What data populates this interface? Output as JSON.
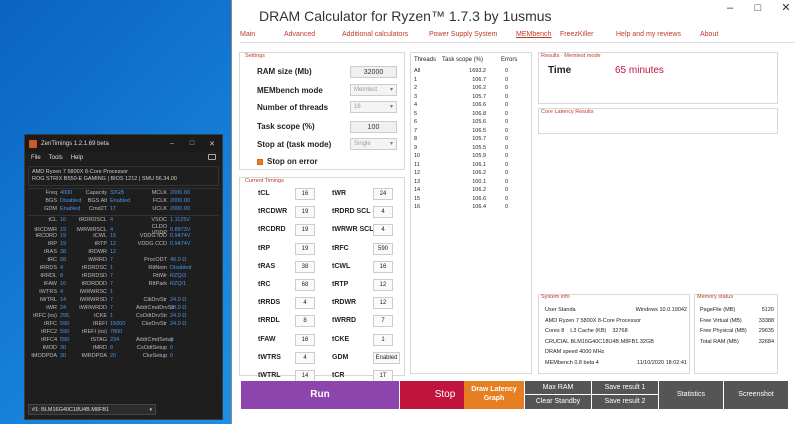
{
  "zen": {
    "title": "ZenTimings 1.2.1.69 beta",
    "menu": [
      "File",
      "Tools",
      "Help"
    ],
    "cpu": "AMD Ryzen 7 5800X 8-Core Processor",
    "board": "ROG STRIX B550-E GAMING | BIOS 1212 | SMU 56.34.00",
    "top": [
      [
        "Freq",
        "4000",
        "Capacity",
        "32GB",
        "MCLK",
        "2000.00"
      ],
      [
        "BGS",
        "Disabled",
        "BGS Alt",
        "Enabled",
        "FCLK",
        "2000.00"
      ],
      [
        "GDM",
        "Enabled",
        "Cmd2T",
        "1T",
        "UCLK",
        "2000.00"
      ]
    ],
    "rows": [
      [
        "tCL",
        "16",
        "tRDRDSCL",
        "4",
        "VSOC",
        "1.1125V"
      ],
      [
        "tRCDWR",
        "19",
        "tWRWRSCL",
        "4",
        "CLDO VDDP",
        "0.8973V"
      ],
      [
        "tRCDRD",
        "19",
        "tCWL",
        "16",
        "VDDG IOD",
        "0.9474V"
      ],
      [
        "tRP",
        "19",
        "tRTP",
        "12",
        "VDDG CCD",
        "0.9474V"
      ],
      [
        "tRAS",
        "38",
        "tRDWR",
        "12",
        "",
        ""
      ],
      [
        "tRC",
        "68",
        "tWRRD",
        "7",
        "ProcODT",
        "40.0 Ω"
      ],
      [
        "tRRDS",
        "4",
        "tRDRDSC",
        "1",
        "RttNom",
        "Disabled"
      ],
      [
        "tRRDL",
        "8",
        "tRDRDSD",
        "7",
        "RttWr",
        "RZQ/3"
      ],
      [
        "tFAW",
        "16",
        "tRDRDDD",
        "7",
        "RttPark",
        "RZQ/1"
      ],
      [
        "tWTRS",
        "4",
        "tWRWRSC",
        "1",
        "",
        ""
      ],
      [
        "tWTRL",
        "14",
        "tWRWRSD",
        "7",
        "ClkDrvStr",
        "24.0 Ω"
      ],
      [
        "tWR",
        "24",
        "tWRWRDD",
        "7",
        "AddrCmdDrvStr",
        "20.0 Ω"
      ],
      [
        "tRFC (ns)",
        "295",
        "tCKE",
        "1",
        "CsOdtDrvStr",
        "24.0 Ω"
      ],
      [
        "tRFC",
        "590",
        "tREFI",
        "15600",
        "CkeDrvStr",
        "24.0 Ω"
      ],
      [
        "tRFC2",
        "590",
        "tREFI (ns)",
        "7800",
        "",
        ""
      ],
      [
        "tRFC4",
        "590",
        "tSTAG",
        "234",
        "AddrCmdSetup",
        "0"
      ],
      [
        "tMOD",
        "30",
        "tMRD",
        "8",
        "CsOdtSetup",
        "0"
      ],
      [
        "tMODPDA",
        "30",
        "tMRDPDA",
        "20",
        "CkeSetup",
        "0"
      ]
    ],
    "dimm": "#1: BLM16G40C18U4B.M8FB1"
  },
  "dc": {
    "title": "DRAM Calculator for Ryzen™ 1.7.3 by 1usmus",
    "tabs": [
      "Main",
      "Advanced",
      "Additional calculators",
      "Power Supply System",
      "MEMbench",
      "FreezKiller",
      "Help and my reviews",
      "About"
    ],
    "settings": {
      "title": "Settings",
      "ram_label": "RAM size (Mb)",
      "ram": "32000",
      "mode_label": "MEMbench mode",
      "mode": "Memtest",
      "threads_label": "Number of threads",
      "threads": "16",
      "scope_label": "Task scope (%)",
      "scope": "100",
      "stop_label": "Stop at (task mode)",
      "stop": "Single",
      "stoperr": "Stop on error"
    },
    "timings_title": "Current Timings",
    "t1": [
      [
        "tCL",
        "16"
      ],
      [
        "tRCDWR",
        "19"
      ],
      [
        "tRCDRD",
        "19"
      ],
      [
        "tRP",
        "19"
      ],
      [
        "tRAS",
        "38"
      ],
      [
        "tRC",
        "68"
      ],
      [
        "tRRDS",
        "4"
      ],
      [
        "tRRDL",
        "8"
      ],
      [
        "tFAW",
        "16"
      ],
      [
        "tWTRS",
        "4"
      ],
      [
        "tWTRL",
        "14"
      ]
    ],
    "t2": [
      [
        "tWR",
        "24"
      ],
      [
        "tRDRD SCL",
        "4"
      ],
      [
        "tWRWR SCL",
        "4"
      ],
      [
        "tRFC",
        "590"
      ],
      [
        "tCWL",
        "16"
      ],
      [
        "tRTP",
        "12"
      ],
      [
        "tRDWR",
        "12"
      ],
      [
        "tWRRD",
        "7"
      ],
      [
        "tCKE",
        "1"
      ],
      [
        "GDM",
        "Enabled"
      ],
      [
        "tCR",
        "1T"
      ]
    ],
    "table": {
      "h": [
        "Threads",
        "Task scope (%)",
        "Errors"
      ],
      "rows": [
        [
          "All",
          "1693.2",
          "0"
        ],
        [
          "1",
          "106.7",
          "0"
        ],
        [
          "2",
          "106.2",
          "0"
        ],
        [
          "3",
          "105.7",
          "0"
        ],
        [
          "4",
          "106.6",
          "0"
        ],
        [
          "5",
          "106.8",
          "0"
        ],
        [
          "6",
          "105.6",
          "0"
        ],
        [
          "7",
          "106.5",
          "0"
        ],
        [
          "8",
          "105.7",
          "0"
        ],
        [
          "9",
          "105.5",
          "0"
        ],
        [
          "10",
          "105.9",
          "0"
        ],
        [
          "11",
          "106.1",
          "0"
        ],
        [
          "12",
          "106.2",
          "0"
        ],
        [
          "13",
          "100.1",
          "0"
        ],
        [
          "14",
          "106.2",
          "0"
        ],
        [
          "15",
          "106.6",
          "0"
        ],
        [
          "16",
          "106.4",
          "0"
        ]
      ]
    },
    "results": {
      "title": "Results · Memtest mode",
      "time_label": "Time",
      "time": "65 minutes"
    },
    "cl_title": "Core Latency Results",
    "sys": {
      "title": "System info",
      "user": "User Standa",
      "os": "Windows 10.0.19042",
      "cpu": "AMD Ryzen 7 5800X 8-Core Processor",
      "cores": "Cores 8",
      "l3": "L3 Cache (KB)",
      "l3v": "32768",
      "dimm": "CRUCIAL BLM16G40C18U4B.M8FB1.32GB",
      "speed": "DRAM speed 4000 MHz",
      "mb": "MEMbench 0.8 beta 4",
      "date": "11/10/2020 18:02:41"
    },
    "mem": {
      "title": "Memory status",
      "rows": [
        [
          "PageFile (MB)",
          "5120"
        ],
        [
          "Free Virtual (MB)",
          "33388"
        ],
        [
          "Free Physical (MB)",
          "29635"
        ],
        [
          "Total RAM (MB)",
          "32684"
        ]
      ]
    },
    "buttons": {
      "run": "Run",
      "stop": "Stop",
      "draw": "Draw Latency Graph",
      "maxram": "Max RAM",
      "clearstandby": "Clear Standby",
      "save1": "Save result 1",
      "save2": "Save result 2",
      "stats": "Statistics",
      "shot": "Screenshot"
    },
    "colors": {
      "run": "#8e44ad",
      "stop": "#c0143c",
      "draw": "#e67e22",
      "gray": "#555"
    }
  }
}
